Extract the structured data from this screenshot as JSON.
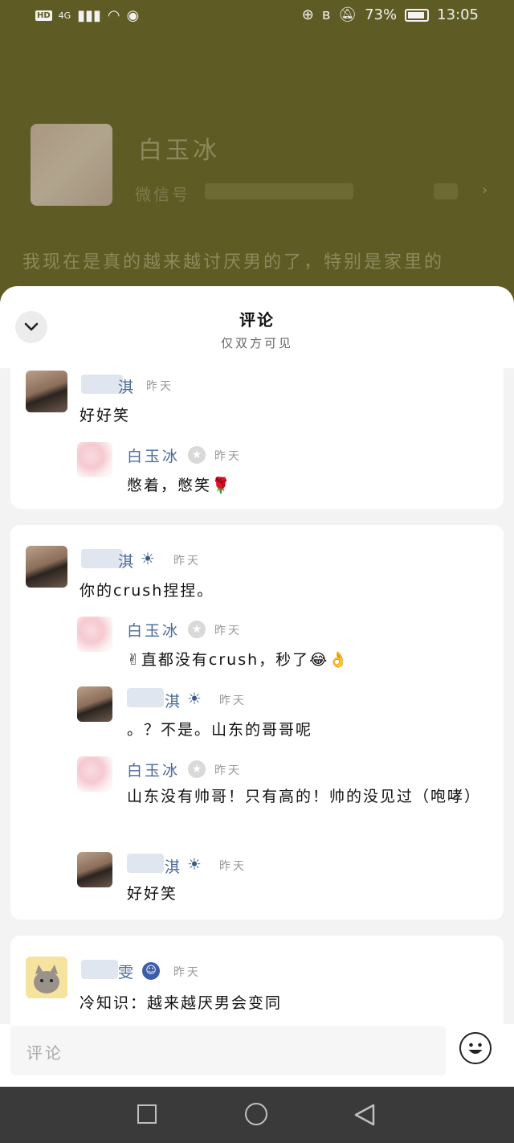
{
  "status": {
    "network": "4G",
    "battery": "73%",
    "time": "13:05"
  },
  "background_chat": {
    "name": "白玉冰",
    "wechat_label": "微信号",
    "message": "我现在是真的越来越讨厌男的了，特别是家里的"
  },
  "sheet": {
    "title": "评论",
    "subtitle": "仅双方可见"
  },
  "comments": {
    "c1": {
      "user": "淇",
      "time": "昨天",
      "text": "好好笑",
      "reply1": {
        "user": "白玉冰",
        "time": "昨天",
        "text": "憋着，憋笑🌹"
      }
    },
    "c2": {
      "user": "淇",
      "time": "昨天",
      "text": "你的crush捏捏。",
      "reply1": {
        "user": "白玉冰",
        "time": "昨天",
        "text": "✌直都没有crush，秒了😂👌"
      },
      "reply2": {
        "user": "淇",
        "time": "昨天",
        "text": "。？不是。山东的哥哥呢"
      },
      "reply3": {
        "user": "白玉冰",
        "time": "昨天",
        "text": "山东没有帅哥！只有高的！帅的没见过（咆哮）"
      },
      "reply4": {
        "user": "淇",
        "time": "昨天",
        "text": "好好笑"
      }
    },
    "c3": {
      "user": "雯",
      "time": "昨天",
      "text": "冷知识：越来越厌男会变同"
    }
  },
  "input": {
    "placeholder": "评论"
  },
  "icons": {
    "back": "chevron-down-icon",
    "emoji": "smiley-icon"
  }
}
